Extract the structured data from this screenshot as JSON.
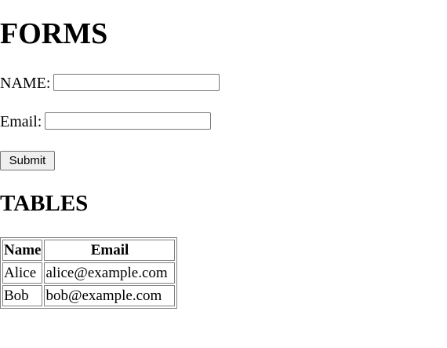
{
  "forms_section": {
    "heading": "FORMS",
    "name_label": "NAME:",
    "name_value": "",
    "email_label": "Email:",
    "email_value": "",
    "submit_label": "Submit"
  },
  "tables_section": {
    "heading": "TABLES",
    "columns": [
      "Name",
      "Email"
    ],
    "rows": [
      [
        "Alice",
        "alice@example.com"
      ],
      [
        "Bob",
        "bob@example.com"
      ]
    ]
  }
}
